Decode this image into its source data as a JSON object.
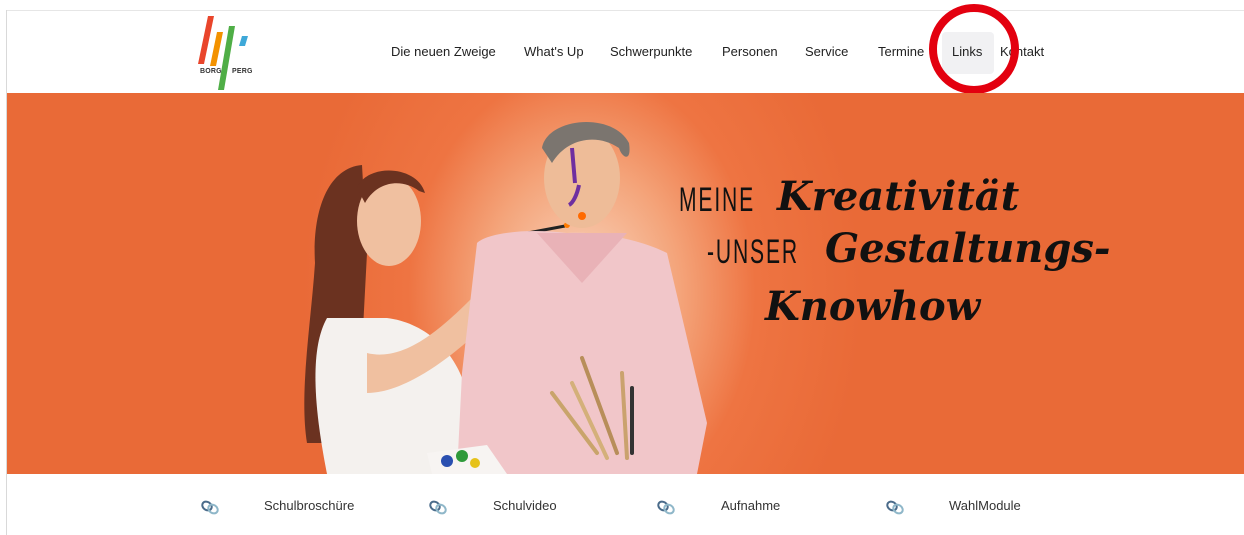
{
  "logo": {
    "text_left": "BORG",
    "text_right": "PERG",
    "colors": [
      "#e9452b",
      "#f39200",
      "#4fae46",
      "#3ea8d8"
    ]
  },
  "nav": {
    "items": [
      {
        "label": "Die neuen Zweige"
      },
      {
        "label": "What's Up"
      },
      {
        "label": "Schwerpunkte"
      },
      {
        "label": "Personen"
      },
      {
        "label": "Service"
      },
      {
        "label": "Termine"
      },
      {
        "label": "Links",
        "active": true
      },
      {
        "label": "Kontakt"
      }
    ]
  },
  "hero": {
    "line1_a": "MEINE",
    "line1_b": "Kreativität",
    "line2_a": "-UNSER",
    "line2_b": "Gestaltungs-",
    "line3": "Knowhow",
    "accent": "#e96a37"
  },
  "quick_links": [
    {
      "label": "Schulbroschüre",
      "icon": "link-icon"
    },
    {
      "label": "Schulvideo",
      "icon": "link-icon"
    },
    {
      "label": "Aufnahme",
      "icon": "link-icon"
    },
    {
      "label": "WahlModule",
      "icon": "link-icon"
    }
  ],
  "highlight_color": "#e3000f"
}
